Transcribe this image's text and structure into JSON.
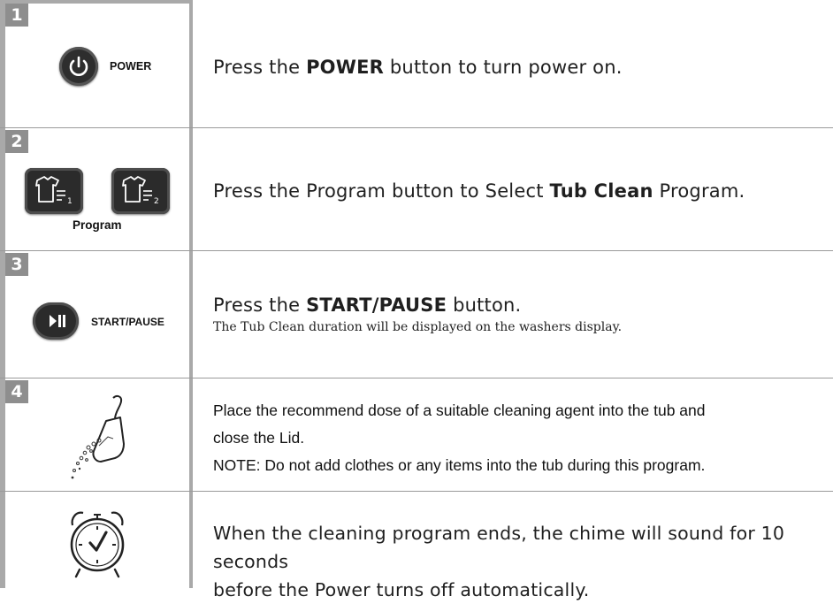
{
  "steps": [
    {
      "number": "1",
      "button_label": "POWER",
      "icon": "power-icon",
      "text_before": "Press the ",
      "text_bold": "POWER",
      "text_after": " button to turn power on."
    },
    {
      "number": "2",
      "button_label": "Program",
      "icon": "shirt-program-icon",
      "text_before": "Press the Program button to Select ",
      "text_bold": "Tub Clean",
      "text_after": " Program."
    },
    {
      "number": "3",
      "button_label": "START/PAUSE",
      "icon": "play-pause-icon",
      "text_before": "Press the ",
      "text_bold": "START/PAUSE",
      "text_after": " button.",
      "subtext": "The Tub Clean duration will be displayed on the washers display."
    },
    {
      "number": "4",
      "icon": "scoop-detergent-icon",
      "line1": "Place the recommend dose of a suitable cleaning agent into the tub and",
      "line2": "close the Lid.",
      "line3": "NOTE: Do not add clothes or any items into the tub during this program."
    },
    {
      "icon": "alarm-clock-icon",
      "line1": "When the cleaning program ends, the chime will sound for 10 seconds",
      "line2": "before the Power turns off automatically."
    }
  ]
}
